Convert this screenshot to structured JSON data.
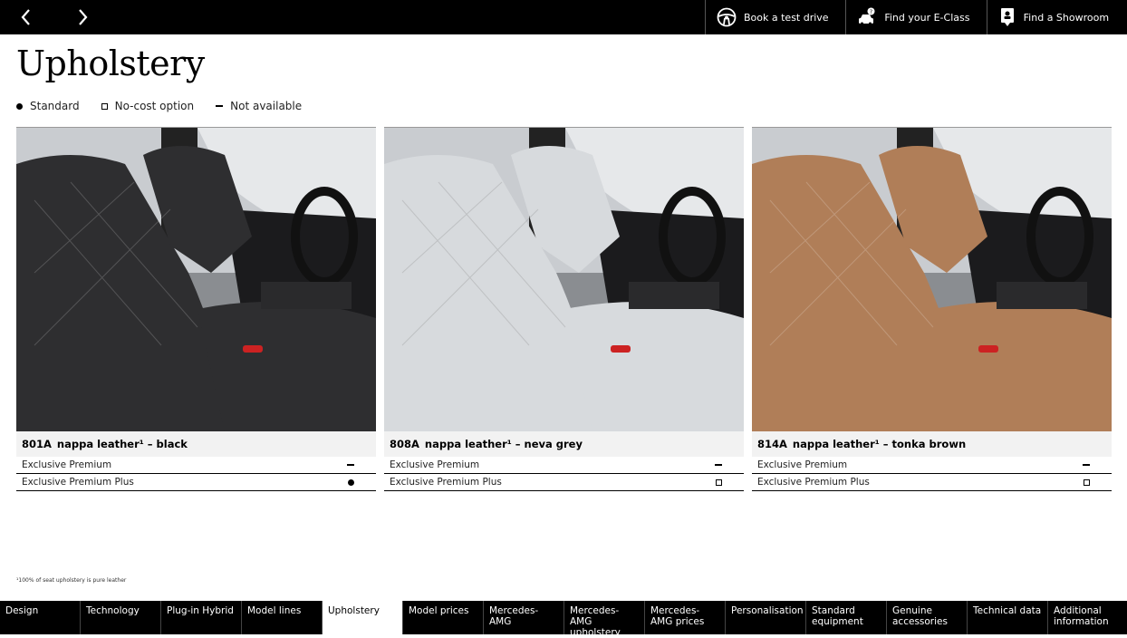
{
  "header": {
    "actions": [
      {
        "label": "Book a test drive",
        "icon": "steering-wheel-icon"
      },
      {
        "label": "Find your E-Class",
        "icon": "car-search-icon"
      },
      {
        "label": "Find a Showroom",
        "icon": "map-pin-icon"
      }
    ]
  },
  "page": {
    "title": "Upholstery"
  },
  "legend": [
    {
      "symbol": "dot",
      "label": "Standard"
    },
    {
      "symbol": "box",
      "label": "No-cost option"
    },
    {
      "symbol": "dash",
      "label": "Not available"
    }
  ],
  "cards": [
    {
      "code": "801A",
      "name": "nappa leather¹ – black",
      "seat_color": "#2e2e30",
      "rows": [
        {
          "label": "Exclusive Premium",
          "symbol": "dash"
        },
        {
          "label": "Exclusive Premium Plus",
          "symbol": "dot"
        }
      ]
    },
    {
      "code": "808A",
      "name": "nappa leather¹ – neva grey",
      "seat_color": "#d7dadd",
      "rows": [
        {
          "label": "Exclusive Premium",
          "symbol": "dash"
        },
        {
          "label": "Exclusive Premium Plus",
          "symbol": "box"
        }
      ]
    },
    {
      "code": "814A",
      "name": "nappa leather¹ – tonka brown",
      "seat_color": "#b07e58",
      "rows": [
        {
          "label": "Exclusive Premium",
          "symbol": "dash"
        },
        {
          "label": "Exclusive Premium Plus",
          "symbol": "box"
        }
      ]
    }
  ],
  "footnote": "¹100% of seat upholstery is pure leather",
  "bottom_nav": [
    {
      "label": "Design"
    },
    {
      "label": "Technology"
    },
    {
      "label": "Plug-in Hybrid"
    },
    {
      "label": "Model lines"
    },
    {
      "label": "Upholstery",
      "active": true
    },
    {
      "label": "Model prices"
    },
    {
      "label": "Mercedes-AMG"
    },
    {
      "label": "Mercedes-AMG upholstery"
    },
    {
      "label": "Mercedes-AMG prices"
    },
    {
      "label": "Personalisation"
    },
    {
      "label": "Standard equipment"
    },
    {
      "label": "Genuine accessories"
    },
    {
      "label": "Technical data"
    },
    {
      "label": "Additional information"
    }
  ]
}
